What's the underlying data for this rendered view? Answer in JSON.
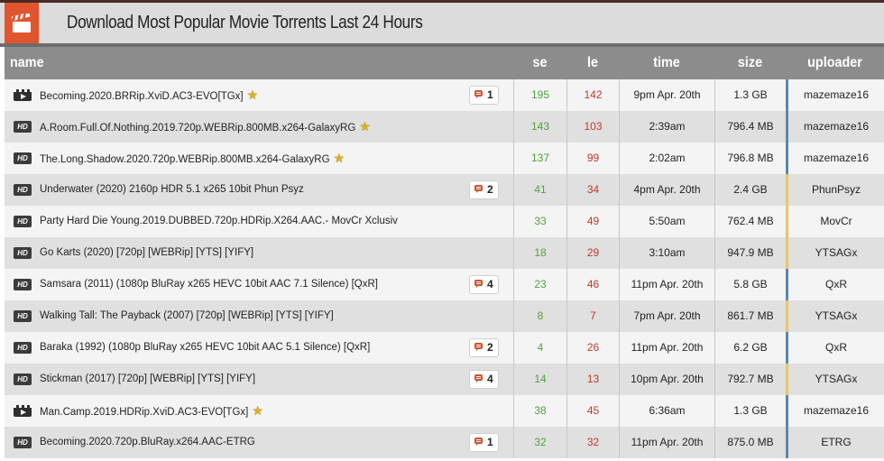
{
  "page": {
    "title": "Download Most Popular Movie Torrents Last 24 Hours",
    "icon": "clapperboard-icon",
    "accent": "#e0552e"
  },
  "table": {
    "headers": {
      "name": "name",
      "se": "se",
      "le": "le",
      "time": "time",
      "size": "size",
      "uploader": "uploader"
    },
    "rows": [
      {
        "type": "movie",
        "name": "Becoming.2020.BRRip.XviD.AC3-EVO[TGx]",
        "star": true,
        "comments": "1",
        "se": "195",
        "le": "142",
        "time": "9pm Apr. 20th",
        "size": "1.3 GB",
        "uploader": "mazemaze16",
        "uploader_class": "vip"
      },
      {
        "type": "hd",
        "name": "A.Room.Full.Of.Nothing.2019.720p.WEBRip.800MB.x264-GalaxyRG",
        "star": true,
        "comments": "",
        "se": "143",
        "le": "103",
        "time": "2:39am",
        "size": "796.4 MB",
        "uploader": "mazemaze16",
        "uploader_class": "vip"
      },
      {
        "type": "hd",
        "name": "The.Long.Shadow.2020.720p.WEBRip.800MB.x264-GalaxyRG",
        "star": true,
        "comments": "",
        "se": "137",
        "le": "99",
        "time": "2:02am",
        "size": "796.8 MB",
        "uploader": "mazemaze16",
        "uploader_class": "vip"
      },
      {
        "type": "hd",
        "name": "Underwater (2020) 2160p HDR 5.1 x265 10bit Phun Psyz",
        "star": false,
        "comments": "2",
        "se": "41",
        "le": "34",
        "time": "4pm Apr. 20th",
        "size": "2.4 GB",
        "uploader": "PhunPsyz",
        "uploader_class": "trusted"
      },
      {
        "type": "hd",
        "name": "Party Hard Die Young.2019.DUBBED.720p.HDRip.X264.AAC.- MovCr Xclusiv",
        "star": false,
        "comments": "",
        "se": "33",
        "le": "49",
        "time": "5:50am",
        "size": "762.4 MB",
        "uploader": "MovCr",
        "uploader_class": "trusted"
      },
      {
        "type": "hd",
        "name": "Go Karts (2020) [720p] [WEBRip] [YTS] [YIFY]",
        "star": false,
        "comments": "",
        "se": "18",
        "le": "29",
        "time": "3:10am",
        "size": "947.9 MB",
        "uploader": "YTSAGx",
        "uploader_class": "trusted"
      },
      {
        "type": "hd",
        "name": "Samsara (2011) (1080p BluRay x265 HEVC 10bit AAC 7.1 Silence) [QxR]",
        "star": false,
        "comments": "4",
        "se": "23",
        "le": "46",
        "time": "11pm Apr. 20th",
        "size": "5.8 GB",
        "uploader": "QxR",
        "uploader_class": "vip"
      },
      {
        "type": "hd",
        "name": "Walking Tall: The Payback (2007) [720p] [WEBRip] [YTS] [YIFY]",
        "star": false,
        "comments": "",
        "se": "8",
        "le": "7",
        "time": "7pm Apr. 20th",
        "size": "861.7 MB",
        "uploader": "YTSAGx",
        "uploader_class": "trusted"
      },
      {
        "type": "hd",
        "name": "Baraka (1992) (1080p BluRay x265 HEVC 10bit AAC 5.1 Silence) [QxR]",
        "star": false,
        "comments": "2",
        "se": "4",
        "le": "26",
        "time": "11pm Apr. 20th",
        "size": "6.2 GB",
        "uploader": "QxR",
        "uploader_class": "vip"
      },
      {
        "type": "hd",
        "name": "Stickman (2017) [720p] [WEBRip] [YTS] [YIFY]",
        "star": false,
        "comments": "4",
        "se": "14",
        "le": "13",
        "time": "10pm Apr. 20th",
        "size": "792.7 MB",
        "uploader": "YTSAGx",
        "uploader_class": "trusted"
      },
      {
        "type": "movie",
        "name": "Man.Camp.2019.HDRip.XviD.AC3-EVO[TGx]",
        "star": true,
        "comments": "",
        "se": "38",
        "le": "45",
        "time": "6:36am",
        "size": "1.3 GB",
        "uploader": "mazemaze16",
        "uploader_class": "vip"
      },
      {
        "type": "hd",
        "name": "Becoming.2020.720p.BluRay.x264.AAC-ETRG",
        "star": false,
        "comments": "1",
        "se": "32",
        "le": "32",
        "time": "11pm Apr. 20th",
        "size": "875.0 MB",
        "uploader": "ETRG",
        "uploader_class": "vip"
      }
    ]
  },
  "icons": {
    "hd_label": "HD",
    "star_glyph": "★"
  },
  "colors": {
    "seeders": "#4fa33a",
    "leechers": "#c0392b",
    "vip_bar": "#5d87ae",
    "trusted_bar": "#e9c56a",
    "header_bg": "#8c8c8c"
  }
}
